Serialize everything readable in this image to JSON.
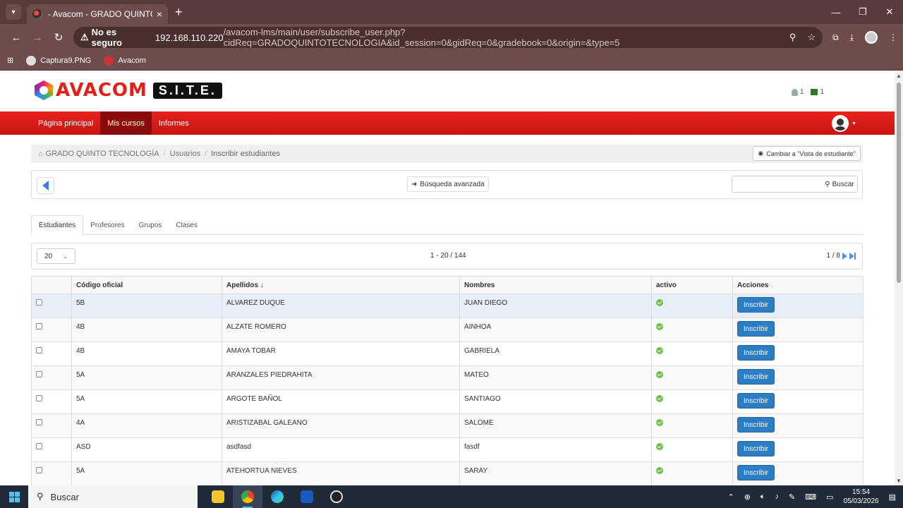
{
  "browser": {
    "tab_title": "- Avacom - GRADO QUINTO TEC",
    "security_label": "No es seguro",
    "url_host": "192.168.110.220",
    "url_path": "/avacom-lms/main/user/subscribe_user.php?cidReq=GRADOQUINTOTECNOLOGIA&id_session=0&gidReq=0&gradebook=0&origin=&type=5",
    "bookmarks": [
      "Captura9.PNG",
      "Avacom"
    ]
  },
  "site": {
    "logo_text": "AVACOM",
    "logo_badge": "S.I.T.E.",
    "notif_users": "1",
    "notif_msgs": "1",
    "nav": [
      "Página principal",
      "Mis cursos",
      "Informes"
    ]
  },
  "breadcrumb": {
    "course": "GRADO QUINTO TECNOLOGÍA",
    "users": "Usuarios",
    "current": "Inscribir estudiantes",
    "student_view": "Cambiar a \"Vista de estudiante\""
  },
  "toolbar": {
    "advanced_search": "Búsqueda avanzada",
    "search_button": "Buscar",
    "search_value": ""
  },
  "tabs": [
    "Estudiantes",
    "Profesores",
    "Grupos",
    "Clases"
  ],
  "pager": {
    "per_page": "20",
    "range": "1 - 20 / 144",
    "page": "1 / 8"
  },
  "table": {
    "headers": [
      "Código oficial",
      "Apellidos ↓",
      "Nombres",
      "activo",
      "Acciones"
    ],
    "action_label": "Inscribir",
    "rows": [
      {
        "code": "5B",
        "last": "ALVAREZ DUQUE",
        "first": "JUAN DIEGO"
      },
      {
        "code": "4B",
        "last": "ALZATE ROMERO",
        "first": "AINHOA"
      },
      {
        "code": "4B",
        "last": "AMAYA TOBAR",
        "first": "GABRIELA"
      },
      {
        "code": "5A",
        "last": "ARANZALES PIEDRAHITA",
        "first": "MATEO"
      },
      {
        "code": "5A",
        "last": "ARGOTE BAÑOL",
        "first": "SANTIAGO"
      },
      {
        "code": "4A",
        "last": "ARISTIZABAL GALEANO",
        "first": "SALOME"
      },
      {
        "code": "ASD",
        "last": "asdfasd",
        "first": "fasdf"
      },
      {
        "code": "5A",
        "last": "ATEHORTUA NIEVES",
        "first": "SARAY"
      }
    ]
  },
  "taskbar": {
    "search_label": "Buscar",
    "time": "15:54",
    "date": "05/03/2026"
  },
  "colors": {
    "nav_red": "#e6231f",
    "button_blue": "#2c7dc3",
    "active_green": "#6cc04a"
  }
}
